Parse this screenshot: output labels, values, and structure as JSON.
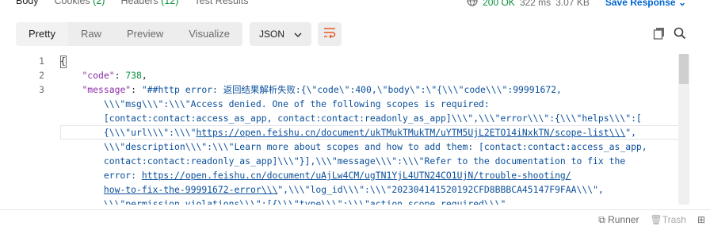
{
  "tabs": [
    {
      "label": "Body",
      "count": ""
    },
    {
      "label": "Cookies",
      "count": "(2)"
    },
    {
      "label": "Headers",
      "count": "(12)"
    },
    {
      "label": "Test Results",
      "count": ""
    }
  ],
  "status": {
    "code": "200 OK",
    "time": "322 ms",
    "size": "3.07 KB",
    "save": "Save Response"
  },
  "view": {
    "modes": [
      "Pretty",
      "Raw",
      "Preview",
      "Visualize"
    ],
    "format": "JSON"
  },
  "editor": {
    "line_numbers": [
      "1",
      "2",
      "3"
    ],
    "lines": [
      [
        {
          "t": "{",
          "c": "p"
        }
      ],
      [
        {
          "t": "    ",
          "c": "p"
        },
        {
          "t": "\"code\"",
          "c": "k"
        },
        {
          "t": ": ",
          "c": "p"
        },
        {
          "t": "738",
          "c": "n"
        },
        {
          "t": ",",
          "c": "p"
        }
      ],
      [
        {
          "t": "    ",
          "c": "p"
        },
        {
          "t": "\"message\"",
          "c": "k"
        },
        {
          "t": ": ",
          "c": "p"
        },
        {
          "t": "\"##http error: 返回结果解析失败:{\\\"code\\\":400,\\\"body\\\":\\\"{\\\\\\\"code\\\\\\\":99991672,",
          "c": "s"
        }
      ],
      [
        {
          "t": "        \\\\\\\"msg\\\\\\\":\\\\\\\"Access denied. One of the following scopes is required:",
          "c": "s"
        }
      ],
      [
        {
          "t": "        [contact:contact:access_as_app, contact:contact:readonly_as_app]\\\\\\\",\\\\\\\"error\\\\\\\":{\\\\\\\"helps\\\\\\\":[",
          "c": "s"
        }
      ],
      [
        {
          "t": "        {\\\\\\\"url\\\\\\\":\\\\\\\"",
          "c": "s"
        },
        {
          "t": "https://open.feishu.cn/document/ukTMukTMukTM/uYTM5UjL2ETO14iNxkTN/scope-list\\\\\\",
          "c": "u"
        },
        {
          "t": "\",",
          "c": "s"
        }
      ],
      [
        {
          "t": "        \\\\\\\"description\\\\\\\":\\\\\\\"Learn more about scopes and how to add them: [contact:contact:access_as_app,",
          "c": "s"
        }
      ],
      [
        {
          "t": "        contact:contact:readonly_as_app]\\\\\\\"}],\\\\\\\"message\\\\\\\":\\\\\\\"Refer to the documentation to fix the",
          "c": "s"
        }
      ],
      [
        {
          "t": "        error: ",
          "c": "s"
        },
        {
          "t": "https://open.feishu.cn/document/uAjLw4CM/ugTN1YjL4UTN24CO1UjN/trouble-shooting/",
          "c": "u"
        }
      ],
      [
        {
          "t": "        ",
          "c": "s"
        },
        {
          "t": "how-to-fix-the-99991672-error\\\\\\",
          "c": "u"
        },
        {
          "t": "\",\\\\\\\"log_id\\\\\\\":\\\\\\\"202304141520192CFD8BBBCA45147F9FAA\\\\\\\",",
          "c": "s"
        }
      ],
      [
        {
          "t": "        \\\\\\\"permission_violations\\\\\\\":[{\\\\\\\"type\\\\\\\":\\\\\\\"action_scope_required\\\\\\\",",
          "c": "s"
        }
      ]
    ]
  },
  "footer": {
    "runner": "Runner",
    "trash": "Trash"
  },
  "colors": {
    "accent": "#0265d2",
    "success": "#0a8f3c",
    "key": "#8b2ca7",
    "string": "#0a4f9b",
    "wrap_icon": "#e8592a"
  }
}
